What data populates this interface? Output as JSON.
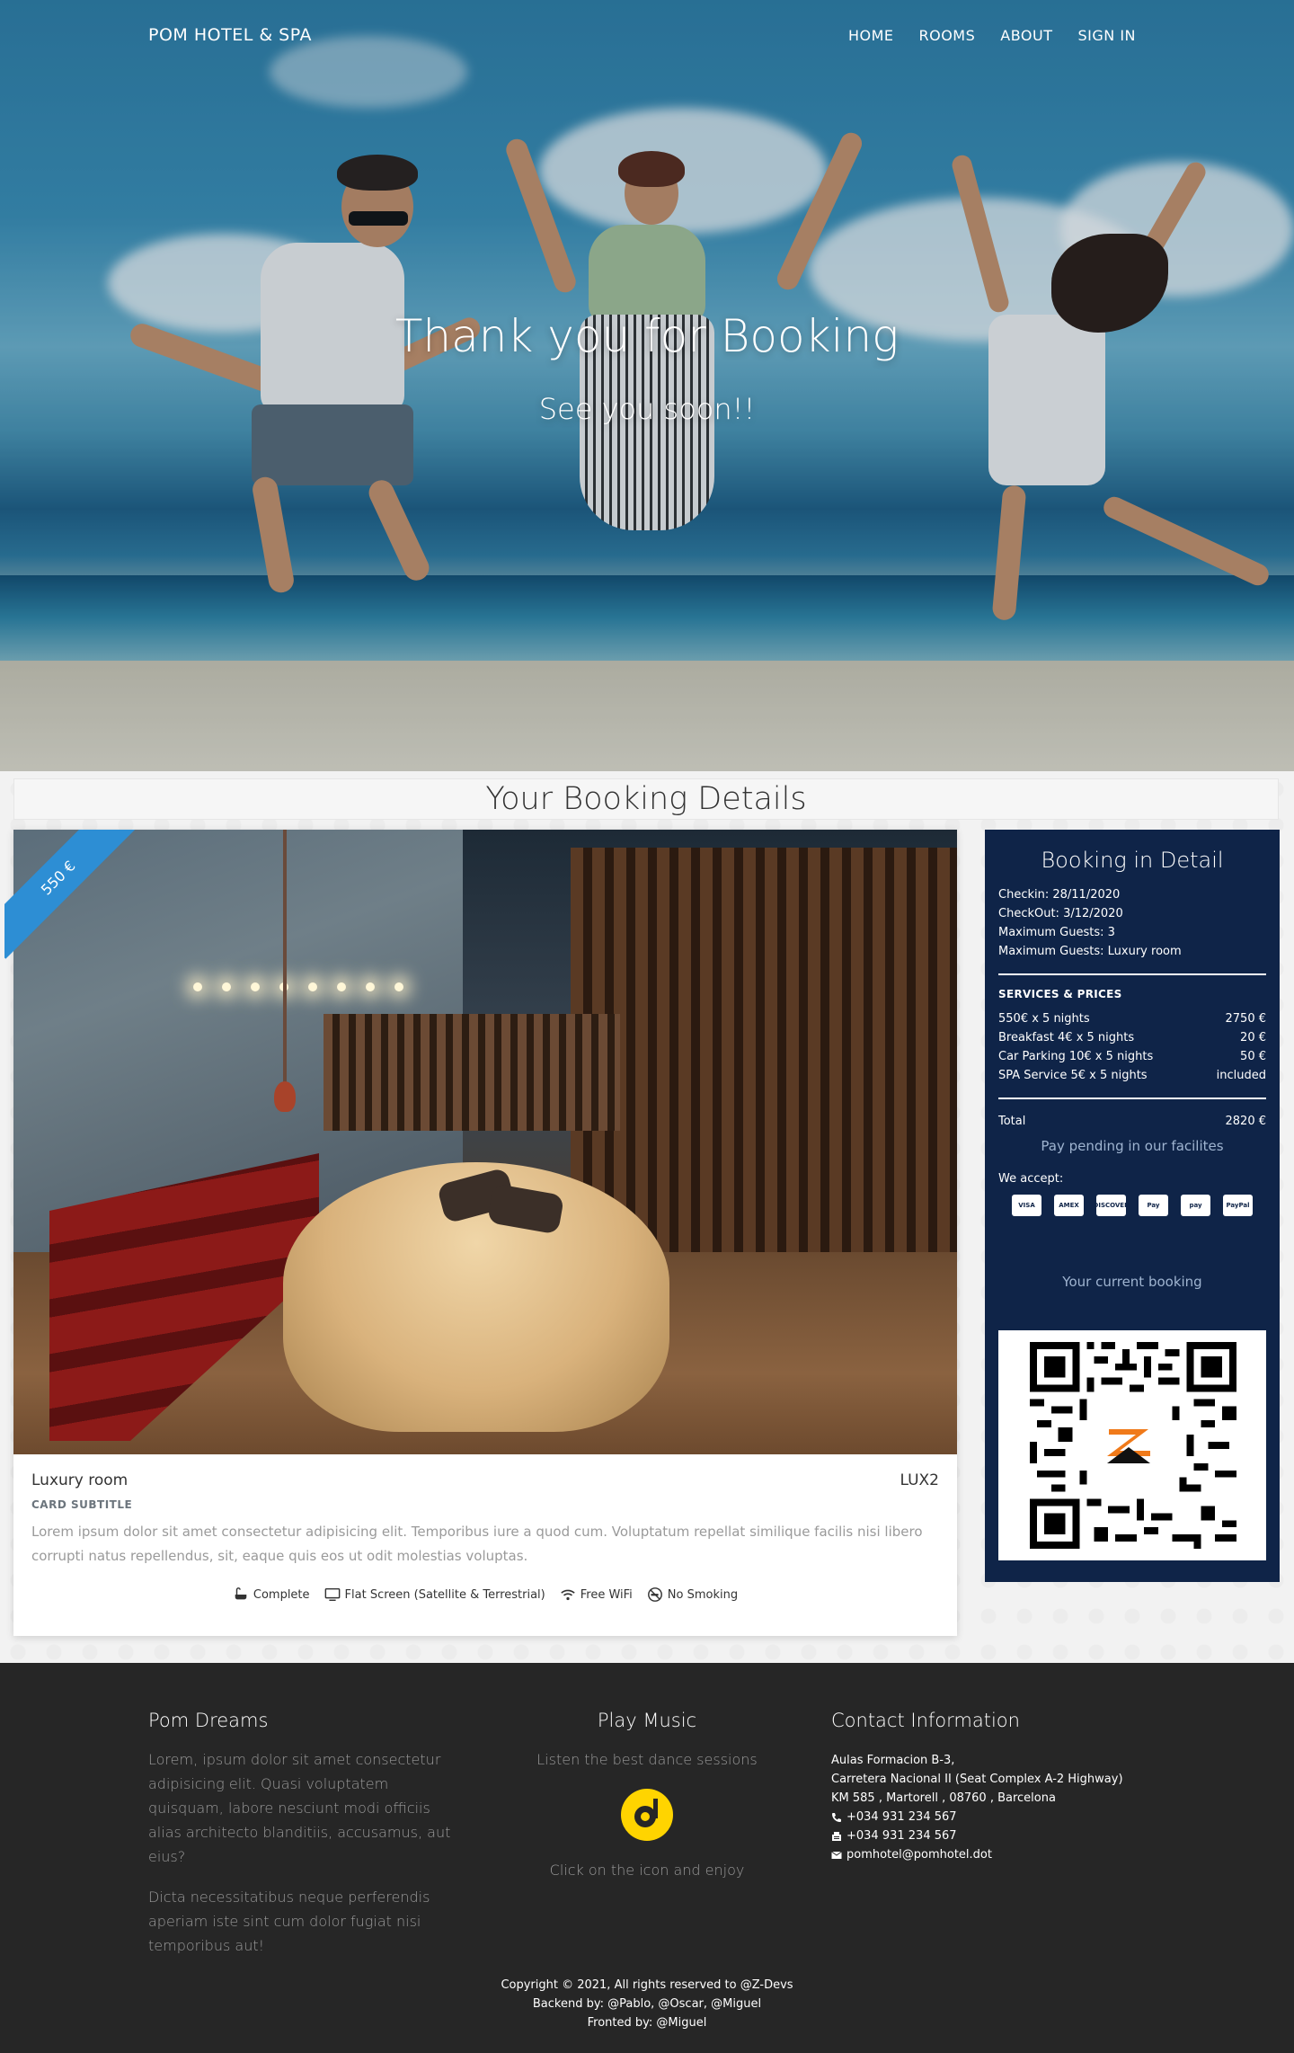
{
  "nav": {
    "brand": "POM HOTEL & SPA",
    "links": [
      "HOME",
      "ROOMS",
      "ABOUT",
      "SIGN IN"
    ]
  },
  "hero": {
    "title": "Thank you for Booking",
    "subtitle": "See you soon!!"
  },
  "booking": {
    "section_title": "Your Booking Details",
    "room": {
      "price_ribbon": "550 €",
      "name": "Luxury room",
      "code": "LUX2",
      "subtitle": "CARD SUBTITLE",
      "description": "Lorem ipsum dolor sit amet consectetur adipisicing elit. Temporibus iure a quod cum. Voluptatum repellat similique facilis nisi libero corrupti natus repellendus, sit, eaque quis eos ut odit molestias voluptas.",
      "amenities": [
        {
          "icon": "bath-icon",
          "label": "Complete"
        },
        {
          "icon": "tv-icon",
          "label": "Flat Screen (Satellite & Terrestrial)"
        },
        {
          "icon": "wifi-icon",
          "label": "Free WiFi"
        },
        {
          "icon": "no-smoking-icon",
          "label": "No Smoking"
        }
      ]
    },
    "detail": {
      "title": "Booking in Detail",
      "info": [
        "Checkin:  28/11/2020",
        "CheckOut:  3/12/2020",
        "Maximum Guests:  3",
        "Maximum Guests:  Luxury room"
      ],
      "services_heading": "SERVICES & PRICES",
      "services": [
        {
          "label": "550€ x 5 nights",
          "price": "2750 €"
        },
        {
          "label": "Breakfast 4€ x 5 nights",
          "price": "20 €"
        },
        {
          "label": "Car Parking 10€ x 5 nights",
          "price": "50 €"
        },
        {
          "label": "SPA Service 5€ x 5 nights",
          "price": "included"
        }
      ],
      "total_label": "Total",
      "total_value": "2820 €",
      "pending": "Pay pending in our facilites",
      "accept_label": "We accept:",
      "payment_methods": [
        "VISA",
        "AMEX",
        "DISCOVER",
        "Pay",
        "pay",
        "PayPal"
      ],
      "current_label": "Your current booking"
    }
  },
  "footer": {
    "about_title": "Pom Dreams",
    "about_p1": "Lorem, ipsum dolor sit amet consectetur adipisicing elit. Quasi voluptatem quisquam, labore nesciunt modi officiis alias architecto blanditiis, accusamus, aut eius?",
    "about_p2": "Dicta necessitatibus neque perferendis aperiam iste sint cum dolor fugiat nisi temporibus aut!",
    "music_title": "Play Music",
    "music_text": "Listen the best dance sessions",
    "music_cta": "Click on the icon and enjoy",
    "contact_title": "Contact Information",
    "address": [
      "Aulas Formacion B-3,",
      "Carretera Nacional II (Seat Complex A-2 Highway)",
      "KM 585 , Martorell , 08760 , Barcelona"
    ],
    "phone": "+034 931 234 567",
    "fax": "+034 931 234 567",
    "email": "pomhotel@pomhotel.dot",
    "copyright": "Copyright © 2021, All rights reserved to @Z-Devs",
    "backend": "Backend by: @Pablo, @Oscar, @Miguel",
    "frontend": "Fronted by: @Miguel"
  }
}
